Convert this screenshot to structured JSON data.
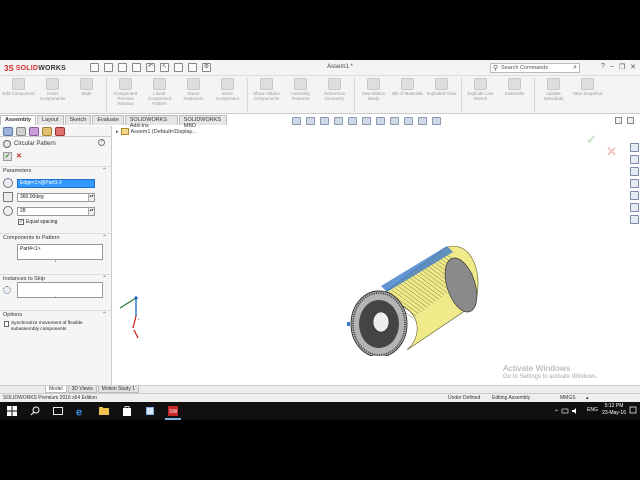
{
  "app": {
    "logo_prefix": "3S",
    "logo_text_red": "SOLID",
    "logo_text_dark": "WORKS",
    "document_title": "Assem1 *",
    "search_placeholder": "Search Commands"
  },
  "ribbon": {
    "commands": [
      {
        "label": "Edit Component"
      },
      {
        "label": "Insert Components"
      },
      {
        "label": "Mate"
      },
      {
        "label": "Component Preview Window"
      },
      {
        "label": "Linear Component Pattern"
      },
      {
        "label": "Smart Fasteners"
      },
      {
        "label": "Move Component"
      },
      {
        "label": "Show Hidden Components"
      },
      {
        "label": "Assembly Features"
      },
      {
        "label": "Reference Geometry"
      },
      {
        "label": "New Motion Study"
      },
      {
        "label": "Bill of Materials"
      },
      {
        "label": "Exploded View"
      },
      {
        "label": "Explode Line Sketch"
      },
      {
        "label": "Instant3D"
      },
      {
        "label": "Update Speedpak"
      },
      {
        "label": "Take Snapshot"
      }
    ],
    "tabs": [
      "Assembly",
      "Layout",
      "Sketch",
      "Evaluate",
      "SOLIDWORKS Add-Ins",
      "SOLIDWORKS MBD"
    ]
  },
  "property_manager": {
    "title": "Circular Pattern",
    "parameters": {
      "heading": "Parameters",
      "axis_value": "Edge<1>@Part3-2",
      "angle_value": "360.00deg",
      "instances_value": "28",
      "equal_spacing_label": "Equal spacing"
    },
    "components": {
      "heading": "Components to Pattern",
      "value": "Part4<1>"
    },
    "skip": {
      "heading": "Instances to Skip",
      "value": ""
    },
    "options": {
      "heading": "Options",
      "sync_label": "Synchronize movement of flexible subassembly components"
    }
  },
  "viewport": {
    "tree_label": "Assem1  (Default<Display..."
  },
  "watermark": {
    "line1": "Activate Windows",
    "line2": "Go to Settings to activate Windows."
  },
  "bottom_tabs": [
    "Model",
    "3D Views",
    "Motion Study 1"
  ],
  "status": {
    "edition": "SOLIDWORKS Premium 2016 x64 Edition",
    "definition": "Under Defined",
    "mode": "Editing Assembly",
    "units": "MMGS"
  },
  "taskbar": {
    "language": "ENG",
    "time": "5:12 PM",
    "date": "23-May-16"
  },
  "colors": {
    "brand_red": "#d32f2f",
    "selection_blue": "#3399ff",
    "model_yellow": "#f0ea8a"
  }
}
